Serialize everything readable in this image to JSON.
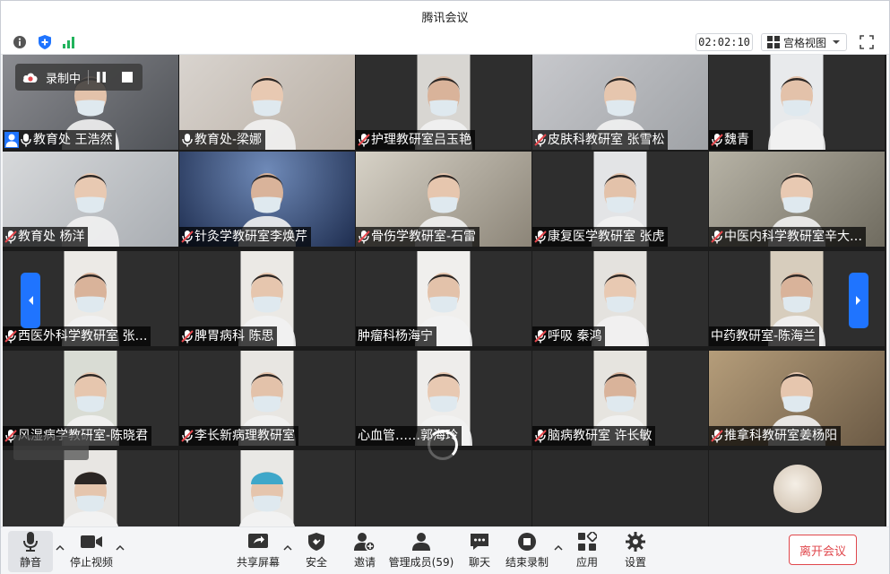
{
  "window": {
    "title": "腾讯会议"
  },
  "toolbar": {
    "info_icon": "info-icon",
    "shield_icon": "shield-icon",
    "signal_icon": "signal-icon",
    "timer": "02:02:10",
    "view_label": "宫格视图",
    "fullscreen_icon": "fullscreen-icon"
  },
  "recording": {
    "label": "录制中"
  },
  "participants": [
    {
      "name": "教育处 王浩然",
      "host": true
    },
    {
      "name": "教育处-梁娜"
    },
    {
      "name": "护理教研室吕玉艳",
      "muted": true
    },
    {
      "name": "皮肤科教研室 张雪松",
      "muted": true
    },
    {
      "name": "魏青",
      "muted": true
    },
    {
      "name": "教育处 杨洋",
      "muted": true
    },
    {
      "name": "针灸学教研室李焕芹",
      "muted": true
    },
    {
      "name": "骨伤学教研室-石雷",
      "muted": true
    },
    {
      "name": "康复医学教研室 张虎",
      "muted": true
    },
    {
      "name": "中医内科学教研室辛大…",
      "muted": true
    },
    {
      "name": "西医外科学教研室 张…",
      "muted": true
    },
    {
      "name": "脾胃病科 陈思",
      "muted": true
    },
    {
      "name": "肿瘤科杨海宁"
    },
    {
      "name": "呼吸 秦鸿",
      "muted": true
    },
    {
      "name": "中药教研室-陈海兰"
    },
    {
      "name": "风湿病学教研室-陈晓君",
      "muted": true
    },
    {
      "name": "李长新病理教研室",
      "muted": true
    },
    {
      "name": "心血管……郭海玲"
    },
    {
      "name": "脑病教研室 许长敏",
      "muted": true
    },
    {
      "name": "推拿科教研室姜杨阳",
      "muted": true
    }
  ],
  "bottombar": {
    "mute": "静音",
    "stop_video": "停止视频",
    "share_screen": "共享屏幕",
    "security": "安全",
    "invite": "邀请",
    "manage_members": "管理成员(59)",
    "chat": "聊天",
    "end_recording": "结束录制",
    "apps": "应用",
    "settings": "设置",
    "leave": "离开会议"
  },
  "colors": {
    "accent": "#1f74ff",
    "leave": "#e0474c",
    "muted_mic": "#e5484d"
  }
}
